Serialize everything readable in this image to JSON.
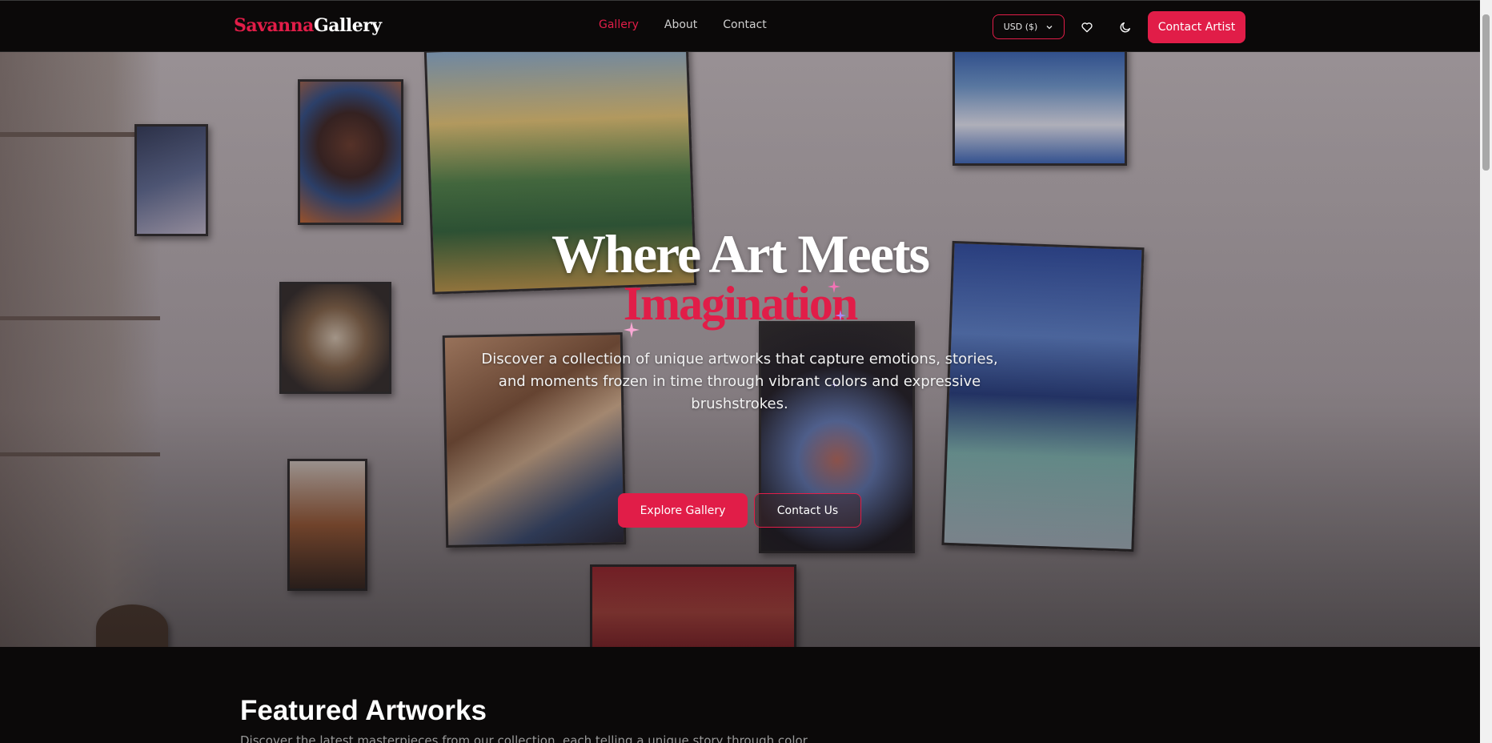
{
  "navbar": {
    "logo_accent": "Savanna",
    "logo_plain": "Gallery",
    "links": [
      {
        "label": "Gallery",
        "active": true
      },
      {
        "label": "About",
        "active": false
      },
      {
        "label": "Contact",
        "active": false
      }
    ],
    "currency": "USD ($)",
    "contact_artist": "Contact Artist",
    "icons": [
      "heart-icon",
      "moon-icon",
      "chevron-down-icon"
    ]
  },
  "hero": {
    "title_line1": "Where Art Meets",
    "title_line2": "Imagination",
    "description": "Discover a collection of unique artworks that capture emotions, stories, and moments frozen in time through vibrant colors and expressive brushstrokes.",
    "explore_button": "Explore Gallery",
    "contact_button": "Contact Us"
  },
  "featured": {
    "title": "Featured Artworks",
    "subtitle": "Discover the latest masterpieces from our collection, each telling a unique story through color."
  },
  "colors": {
    "accent": "#e11d48",
    "background": "#0b0909",
    "text": "#ffffff"
  }
}
